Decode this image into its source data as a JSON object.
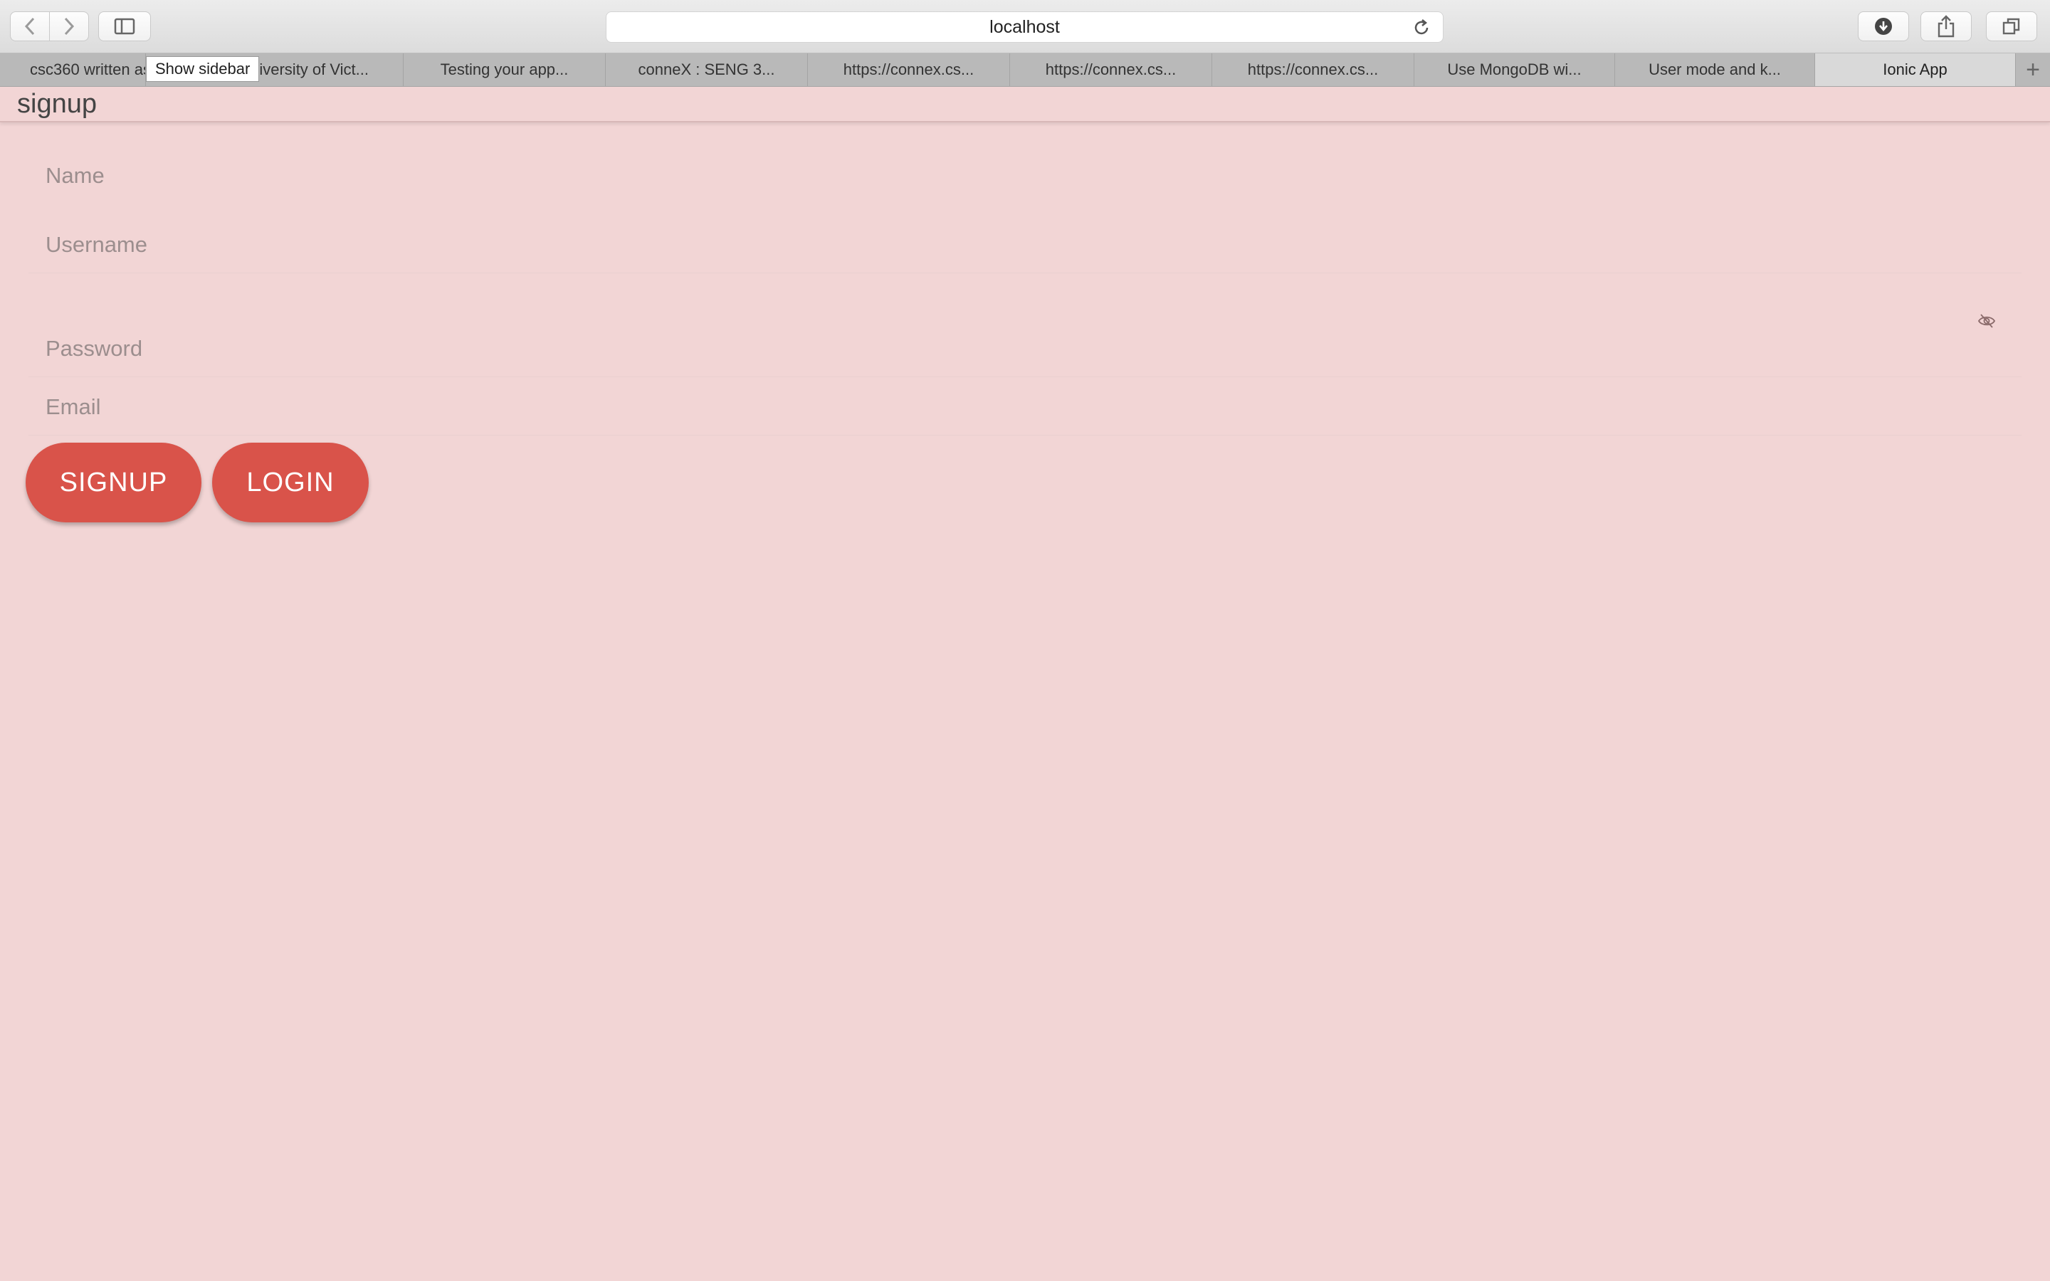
{
  "browser": {
    "address": "localhost",
    "tooltip": "Show sidebar",
    "tabs": [
      {
        "label": "csc360 written assignment"
      },
      {
        "label": "University of Vict..."
      },
      {
        "label": "Testing your app..."
      },
      {
        "label": "conneX : SENG 3..."
      },
      {
        "label": "https://connex.cs..."
      },
      {
        "label": "https://connex.cs..."
      },
      {
        "label": "https://connex.cs..."
      },
      {
        "label": "Use MongoDB wi..."
      },
      {
        "label": "User mode and k..."
      },
      {
        "label": "Ionic App"
      }
    ],
    "active_tab": "Ionic App",
    "new_tab_symbol": "+"
  },
  "app": {
    "title": "signup",
    "fields": {
      "name_placeholder": "Name",
      "username_placeholder": "Username",
      "password_placeholder": "Password",
      "email_placeholder": "Email"
    },
    "buttons": {
      "signup": "SIGNUP",
      "login": "LOGIN"
    }
  },
  "colors": {
    "background": "#f2d5d5",
    "primary": "#d9534a"
  },
  "icons": [
    "back-icon",
    "forward-icon",
    "sidebar-icon",
    "reload-icon",
    "download-icon",
    "share-icon",
    "tabs-overview-icon",
    "eye-off-icon"
  ]
}
